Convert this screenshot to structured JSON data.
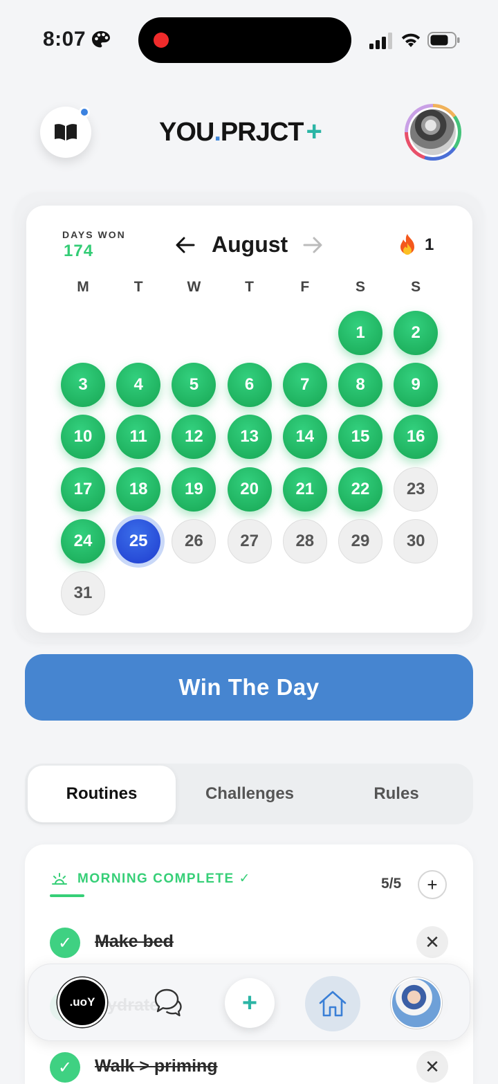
{
  "status_bar": {
    "time": "8:07"
  },
  "header": {
    "brand_main": "YOU",
    "brand_dot": ".",
    "brand_rest": "PRJCT",
    "brand_plus": "+"
  },
  "calendar": {
    "days_won_label": "DAYS WON",
    "days_won_value": "174",
    "month": "August",
    "streak_count": "1",
    "weekdays": [
      "M",
      "T",
      "W",
      "T",
      "F",
      "S",
      "S"
    ],
    "days": [
      {
        "n": "1",
        "state": "won"
      },
      {
        "n": "2",
        "state": "won"
      },
      {
        "n": "3",
        "state": "won"
      },
      {
        "n": "4",
        "state": "won"
      },
      {
        "n": "5",
        "state": "won"
      },
      {
        "n": "6",
        "state": "won"
      },
      {
        "n": "7",
        "state": "won"
      },
      {
        "n": "8",
        "state": "won"
      },
      {
        "n": "9",
        "state": "won"
      },
      {
        "n": "10",
        "state": "won"
      },
      {
        "n": "11",
        "state": "won"
      },
      {
        "n": "12",
        "state": "won"
      },
      {
        "n": "13",
        "state": "won"
      },
      {
        "n": "14",
        "state": "won"
      },
      {
        "n": "15",
        "state": "won"
      },
      {
        "n": "16",
        "state": "won"
      },
      {
        "n": "17",
        "state": "won"
      },
      {
        "n": "18",
        "state": "won"
      },
      {
        "n": "19",
        "state": "won"
      },
      {
        "n": "20",
        "state": "won"
      },
      {
        "n": "21",
        "state": "won"
      },
      {
        "n": "22",
        "state": "won"
      },
      {
        "n": "23",
        "state": "future"
      },
      {
        "n": "24",
        "state": "won"
      },
      {
        "n": "25",
        "state": "today"
      },
      {
        "n": "26",
        "state": "future"
      },
      {
        "n": "27",
        "state": "future"
      },
      {
        "n": "28",
        "state": "future"
      },
      {
        "n": "29",
        "state": "future"
      },
      {
        "n": "30",
        "state": "future"
      },
      {
        "n": "31",
        "state": "future"
      }
    ],
    "first_weekday_index": 5,
    "colors": {
      "won": "#22bb66",
      "today": "#2a4fd8",
      "future": "#efefef"
    }
  },
  "win_button": {
    "label": "Win The Day",
    "color": "#4685d0"
  },
  "tabs": [
    {
      "label": "Routines",
      "active": true
    },
    {
      "label": "Challenges",
      "active": false
    },
    {
      "label": "Rules",
      "active": false
    }
  ],
  "routines": {
    "section_title": "MORNING COMPLETE ✓",
    "count": "5/5",
    "add_label": "+",
    "tasks": [
      {
        "label": "Make bed",
        "done": true
      },
      {
        "label": "Hydrate",
        "done": true
      },
      {
        "label": "Walk > priming",
        "done": true
      }
    ],
    "accent": "#36cf77"
  },
  "bottom_nav": {
    "logo_text": ".uoY",
    "plus_label": "+",
    "items": [
      "logo",
      "chat-icon",
      "add",
      "home-icon",
      "profile-avatar"
    ]
  }
}
